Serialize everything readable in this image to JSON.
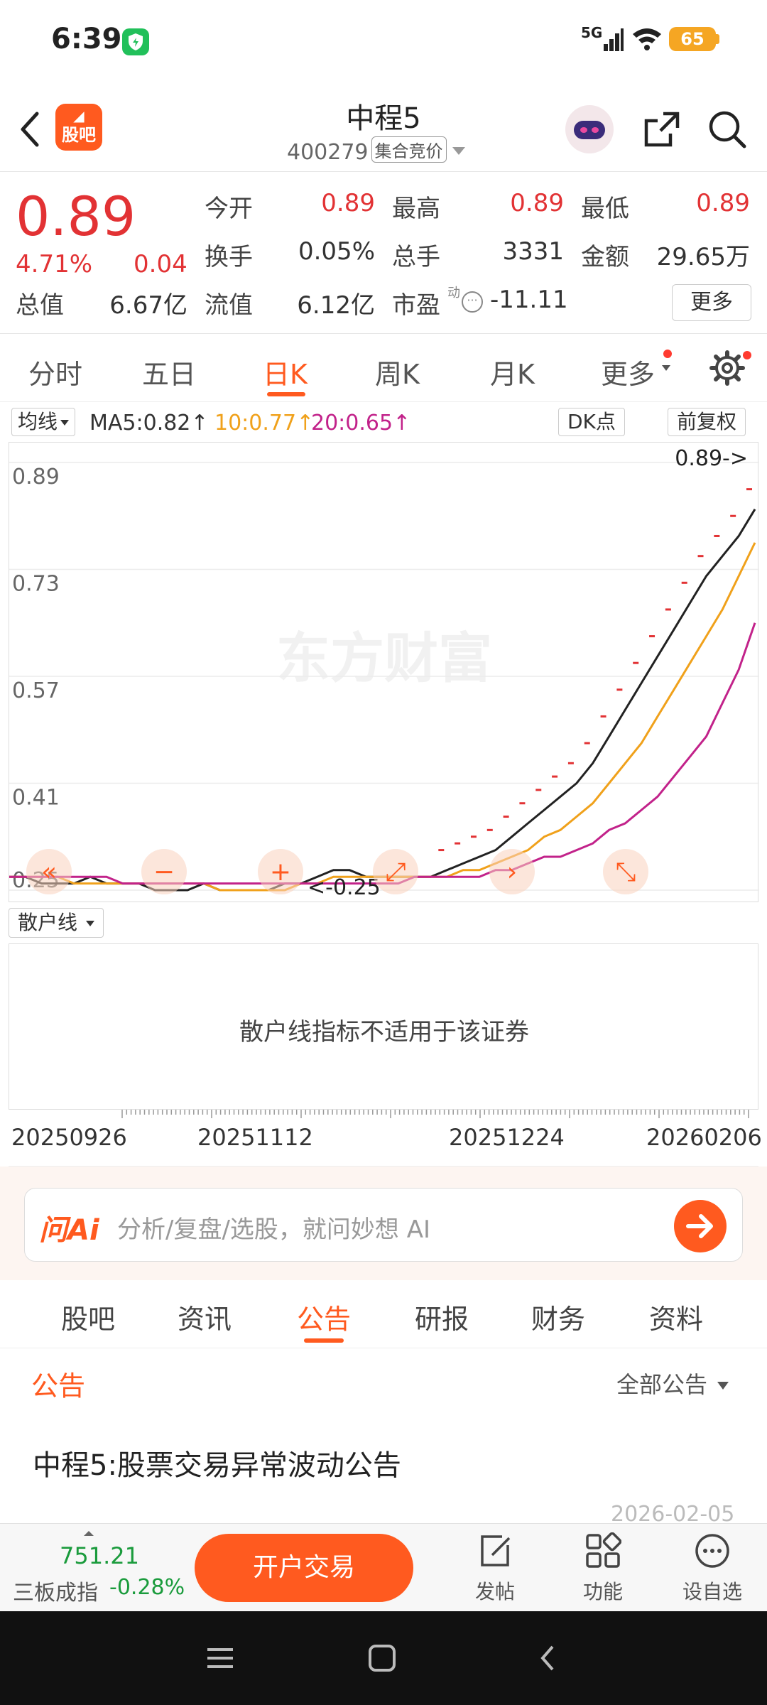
{
  "status": {
    "time": "6:39",
    "network": "5G",
    "battery": "65"
  },
  "header": {
    "title": "中程5",
    "code": "400279",
    "mode": "集合竞价",
    "logo_text": "股吧"
  },
  "quote": {
    "price": "0.89",
    "change_pct": "4.71%",
    "change_amt": "0.04",
    "rows": [
      [
        {
          "label": "今开",
          "value": "0.89",
          "color": "red"
        },
        {
          "label": "最高",
          "value": "0.89",
          "color": "red"
        },
        {
          "label": "最低",
          "value": "0.89",
          "color": "red"
        }
      ],
      [
        {
          "label": "换手",
          "value": "0.05%",
          "color": "dark"
        },
        {
          "label": "总手",
          "value": "3331",
          "color": "dark"
        },
        {
          "label": "金额",
          "value": "29.65万",
          "color": "dark"
        }
      ],
      [
        {
          "label": "总值",
          "value": "6.67亿",
          "color": "dark"
        },
        {
          "label": "流值",
          "value": "6.12亿",
          "color": "dark"
        },
        {
          "label": "市盈",
          "value": "-11.11",
          "color": "dark"
        }
      ]
    ],
    "pe_superscript": "动",
    "more": "更多"
  },
  "period_tabs": [
    "分时",
    "五日",
    "日K",
    "周K",
    "月K",
    "更多"
  ],
  "period_active": "日K",
  "ma_bar": {
    "selector": "均线",
    "ma5": "MA5:0.82↑",
    "ma10": "10:0.77↑",
    "ma20": "20:0.65↑",
    "dk": "DK点",
    "adjust": "前复权",
    "colors": {
      "ma5": "#222222",
      "ma10": "#f0a11b",
      "ma20": "#c2228a"
    }
  },
  "chart_data": {
    "type": "line",
    "y_ticks": [
      "0.89",
      "0.73",
      "0.57",
      "0.41",
      "0.25"
    ],
    "ylim": [
      0.25,
      0.89
    ],
    "high_label": "0.89->",
    "low_label": "<-0.25",
    "watermark": "东方财富",
    "x_labels": [
      "20250926",
      "20251112",
      "20251224",
      "20260206"
    ],
    "series": [
      {
        "name": "MA5",
        "color": "#222222",
        "values": [
          0.27,
          0.27,
          0.26,
          0.26,
          0.26,
          0.27,
          0.26,
          0.26,
          0.26,
          0.25,
          0.25,
          0.25,
          0.26,
          0.25,
          0.25,
          0.25,
          0.25,
          0.26,
          0.26,
          0.27,
          0.28,
          0.28,
          0.27,
          0.27,
          0.27,
          0.27,
          0.27,
          0.28,
          0.29,
          0.3,
          0.31,
          0.33,
          0.35,
          0.37,
          0.39,
          0.41,
          0.44,
          0.48,
          0.52,
          0.56,
          0.6,
          0.64,
          0.68,
          0.72,
          0.75,
          0.78,
          0.82
        ]
      },
      {
        "name": "MA10",
        "color": "#f0a11b",
        "values": [
          0.27,
          0.27,
          0.27,
          0.27,
          0.26,
          0.26,
          0.26,
          0.26,
          0.26,
          0.26,
          0.26,
          0.26,
          0.26,
          0.25,
          0.25,
          0.25,
          0.25,
          0.25,
          0.26,
          0.26,
          0.27,
          0.27,
          0.27,
          0.27,
          0.27,
          0.27,
          0.27,
          0.27,
          0.28,
          0.28,
          0.29,
          0.3,
          0.31,
          0.33,
          0.34,
          0.36,
          0.38,
          0.41,
          0.44,
          0.47,
          0.51,
          0.55,
          0.59,
          0.63,
          0.67,
          0.72,
          0.77
        ]
      },
      {
        "name": "MA20",
        "color": "#c2228a",
        "values": [
          0.27,
          0.27,
          0.27,
          0.27,
          0.27,
          0.27,
          0.27,
          0.26,
          0.26,
          0.26,
          0.26,
          0.26,
          0.26,
          0.26,
          0.26,
          0.26,
          0.26,
          0.26,
          0.26,
          0.26,
          0.26,
          0.26,
          0.26,
          0.26,
          0.26,
          0.27,
          0.27,
          0.27,
          0.27,
          0.27,
          0.28,
          0.28,
          0.29,
          0.3,
          0.3,
          0.31,
          0.32,
          0.34,
          0.35,
          0.37,
          0.39,
          0.42,
          0.45,
          0.48,
          0.53,
          0.58,
          0.65
        ]
      }
    ]
  },
  "indicator": {
    "selector": "散户线",
    "message": "散户线指标不适用于该证券"
  },
  "ai": {
    "logo": "问Ai",
    "placeholder": "分析/复盘/选股，就问妙想 AI"
  },
  "section_tabs": [
    "股吧",
    "资讯",
    "公告",
    "研报",
    "财务",
    "资料"
  ],
  "section_active": "公告",
  "announcement": {
    "heading": "公告",
    "filter": "全部公告",
    "title": "中程5:股票交易异常波动公告",
    "date": "2026-02-05"
  },
  "bottom": {
    "index_value": "751.21",
    "index_name": "三板成指",
    "index_change": "-0.28%",
    "trade": "开户交易",
    "items": [
      "发帖",
      "功能",
      "设自选"
    ]
  }
}
